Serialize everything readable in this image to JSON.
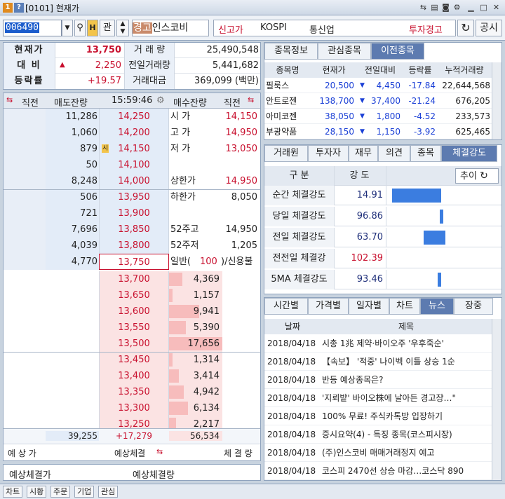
{
  "window": {
    "code": "0101",
    "title": "현재가",
    "icon1": "1",
    "icon2": "?"
  },
  "toolbar": {
    "stock_code": "006490",
    "search_icon": "search-icon",
    "btn_h": "H",
    "btn_gwan": "관",
    "name_tag": "경고",
    "stock_name": "인스코비",
    "menu_new_high": "신고가",
    "market": "KOSPI",
    "sector": "통신업",
    "warning": "투자경고",
    "btn_notice": "공시"
  },
  "summary": {
    "rows": [
      {
        "label": "현재가",
        "value": "13,750",
        "label2": "거 래 량",
        "value2": "25,490,548"
      },
      {
        "label": "대 비",
        "arrow": "▲",
        "value": "2,250",
        "label2": "전일거래량",
        "value2": "5,441,682"
      },
      {
        "label": "등락률",
        "value": "+19.57",
        "label2": "거래대금",
        "value2": "369,099 (백만)"
      }
    ]
  },
  "orderbook": {
    "header": {
      "prev": "직전",
      "ask": "매도잔량",
      "time": "15:59:46",
      "bid": "매수잔량",
      "post": "직전"
    },
    "asks": [
      {
        "qty": "11,286",
        "price": "14,250",
        "info_lbl": "시  가",
        "info_val": "14,150"
      },
      {
        "qty": "1,060",
        "price": "14,200",
        "info_lbl": "고  가",
        "info_val": "14,950"
      },
      {
        "qty": "879",
        "price": "14,150",
        "info_lbl": "저  가",
        "info_val": "13,050",
        "marker": "시"
      },
      {
        "qty": "50",
        "price": "14,100",
        "info_lbl": "",
        "info_val": ""
      },
      {
        "qty": "8,248",
        "price": "14,000",
        "info_lbl": "상한가",
        "info_val": "14,950"
      },
      {
        "qty": "506",
        "price": "13,950",
        "info_lbl": "하한가",
        "info_val": "8,050"
      },
      {
        "qty": "721",
        "price": "13,900",
        "info_lbl": "",
        "info_val": ""
      },
      {
        "qty": "7,696",
        "price": "13,850",
        "info_lbl": "52주고",
        "info_val": "14,950"
      },
      {
        "qty": "4,039",
        "price": "13,800",
        "info_lbl": "52주저",
        "info_val": "1,205"
      },
      {
        "qty": "4,770",
        "price": "13,750",
        "info_lbl": "일반(",
        "info_mid": "100",
        "info_val": ")/신용불가"
      }
    ],
    "bids": [
      {
        "price": "13,700",
        "qty": "4,369",
        "ratio": 0.25
      },
      {
        "price": "13,650",
        "qty": "1,157",
        "ratio": 0.07
      },
      {
        "price": "13,600",
        "qty": "9,941",
        "ratio": 0.56
      },
      {
        "price": "13,550",
        "qty": "5,390",
        "ratio": 0.31
      },
      {
        "price": "13,500",
        "qty": "17,656",
        "ratio": 1.0
      },
      {
        "price": "13,450",
        "qty": "1,314",
        "ratio": 0.07
      },
      {
        "price": "13,400",
        "qty": "3,414",
        "ratio": 0.19
      },
      {
        "price": "13,350",
        "qty": "4,942",
        "ratio": 0.28
      },
      {
        "price": "13,300",
        "qty": "6,134",
        "ratio": 0.35
      },
      {
        "price": "13,250",
        "qty": "2,217",
        "ratio": 0.13
      }
    ],
    "total": {
      "ask": "39,255",
      "diff": "+17,279",
      "bid": "56,534"
    },
    "footer": {
      "expected_price": "예 상 가",
      "expected_fill": "예상체결",
      "fill_qty": "체 결 량"
    }
  },
  "expected": {
    "label1": "예상체결가",
    "label2": "예상체결량"
  },
  "right_top": {
    "tabs": [
      "종목정보",
      "관심종목",
      "이전종목"
    ],
    "active": 2,
    "headers": [
      "종목명",
      "현재가",
      "전일대비",
      "등락률",
      "누적거래량"
    ],
    "rows": [
      {
        "name": "필룩스",
        "price": "20,500",
        "arrow": "▼",
        "change": "4,450",
        "rate": "-17.84",
        "volume": "22,644,568"
      },
      {
        "name": "안트로젠",
        "price": "138,700",
        "arrow": "▼",
        "change": "37,400",
        "rate": "-21.24",
        "volume": "676,205"
      },
      {
        "name": "아미코젠",
        "price": "38,050",
        "arrow": "▼",
        "change": "1,800",
        "rate": "-4.52",
        "volume": "233,573"
      },
      {
        "name": "부광약품",
        "price": "28,150",
        "arrow": "▼",
        "change": "1,150",
        "rate": "-3.92",
        "volume": "625,465"
      }
    ]
  },
  "strength": {
    "tabs": [
      "거래원",
      "투자자",
      "재무",
      "의견",
      "종목",
      "체결강도"
    ],
    "active": 5,
    "header": {
      "gubun": "구  분",
      "gangdo": "강  도",
      "trend_btn": "추이"
    },
    "rows": [
      {
        "label": "순간 체결강도",
        "value": "14.91",
        "bar_start": 0,
        "bar_ratio": 0.14
      },
      {
        "label": "당일 체결강도",
        "value": "96.86",
        "bar_start": 0.97,
        "bar_ratio": 0.01
      },
      {
        "label": "전일 체결강도",
        "value": "63.70",
        "bar_start": 0.64,
        "bar_ratio": 0.06
      },
      {
        "label": "전전일 체결강",
        "value": "102.39",
        "bar_start": 1.0,
        "bar_ratio": 0.0
      },
      {
        "label": "5MA 체결강도",
        "value": "93.46",
        "bar_start": 0.93,
        "bar_ratio": 0.01
      }
    ]
  },
  "news": {
    "tabs": [
      "시간별",
      "가격별",
      "일자별",
      "차트",
      "뉴스",
      "장중"
    ],
    "active": 4,
    "headers": {
      "date": "날짜",
      "title": "제목"
    },
    "rows": [
      {
        "date": "2018/04/18",
        "title": "시총 1兆 제약·바이오주 '우후죽순'"
      },
      {
        "date": "2018/04/18",
        "title": "【속보】 '적중' 나이벡 이틀 상승 1순"
      },
      {
        "date": "2018/04/18",
        "title": "반등 예상종목은?"
      },
      {
        "date": "2018/04/18",
        "title": "'지뢰밭' 바이오株에 날아든 경고장…\""
      },
      {
        "date": "2018/04/18",
        "title": "100% 무료! 주식카톡방 입장하기"
      },
      {
        "date": "2018/04/18",
        "title": "증시요약(4) - 특징 종목(코스피시장)"
      },
      {
        "date": "2018/04/18",
        "title": "(주)인스코비 매매거래정지 예고"
      },
      {
        "date": "2018/04/18",
        "title": "코스피 2470선 상승 마감…코스닥 890"
      }
    ]
  },
  "statusbar": {
    "items": [
      "차트",
      "시황",
      "주문",
      "기업",
      "관심"
    ]
  }
}
